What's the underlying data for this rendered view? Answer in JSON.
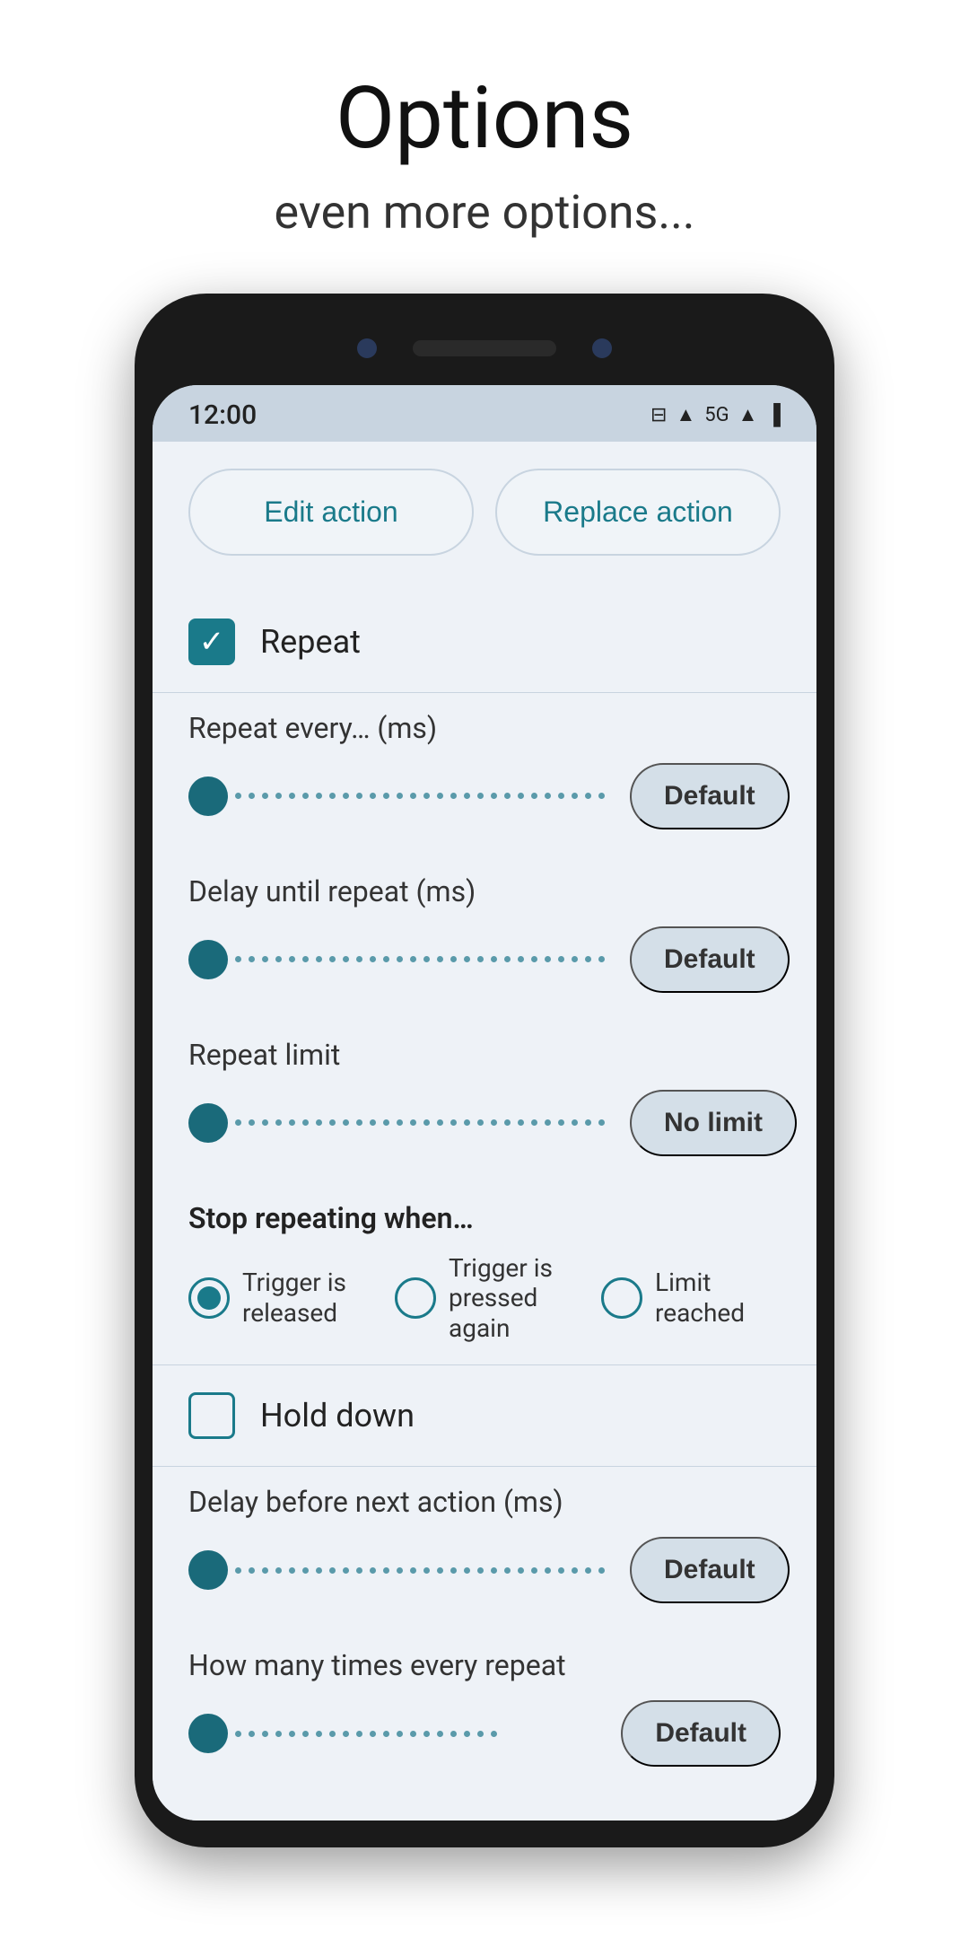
{
  "header": {
    "title": "Options",
    "subtitle": "even more options..."
  },
  "status_bar": {
    "time": "12:00",
    "icons": [
      "⊟",
      "▲",
      "5G",
      "▲",
      "▐"
    ]
  },
  "action_buttons": {
    "edit_label": "Edit action",
    "replace_label": "Replace action"
  },
  "repeat_checkbox": {
    "label": "Repeat",
    "checked": true
  },
  "sliders": [
    {
      "label": "Repeat every… (ms)",
      "value_label": "Default",
      "dot_count": 28
    },
    {
      "label": "Delay until repeat (ms)",
      "value_label": "Default",
      "dot_count": 28
    },
    {
      "label": "Repeat limit",
      "value_label": "No limit",
      "dot_count": 28
    }
  ],
  "stop_repeating": {
    "label": "Stop repeating when…",
    "options": [
      {
        "label": "Trigger is released",
        "selected": true
      },
      {
        "label": "Trigger is pressed again",
        "selected": false
      },
      {
        "label": "Limit reached",
        "selected": false
      }
    ]
  },
  "hold_down": {
    "label": "Hold down",
    "checked": false
  },
  "bottom_sliders": [
    {
      "label": "Delay before next action (ms)",
      "value_label": "Default",
      "dot_count": 28
    },
    {
      "label": "How many times every repeat",
      "value_label": "Default",
      "dot_count": 20
    }
  ]
}
